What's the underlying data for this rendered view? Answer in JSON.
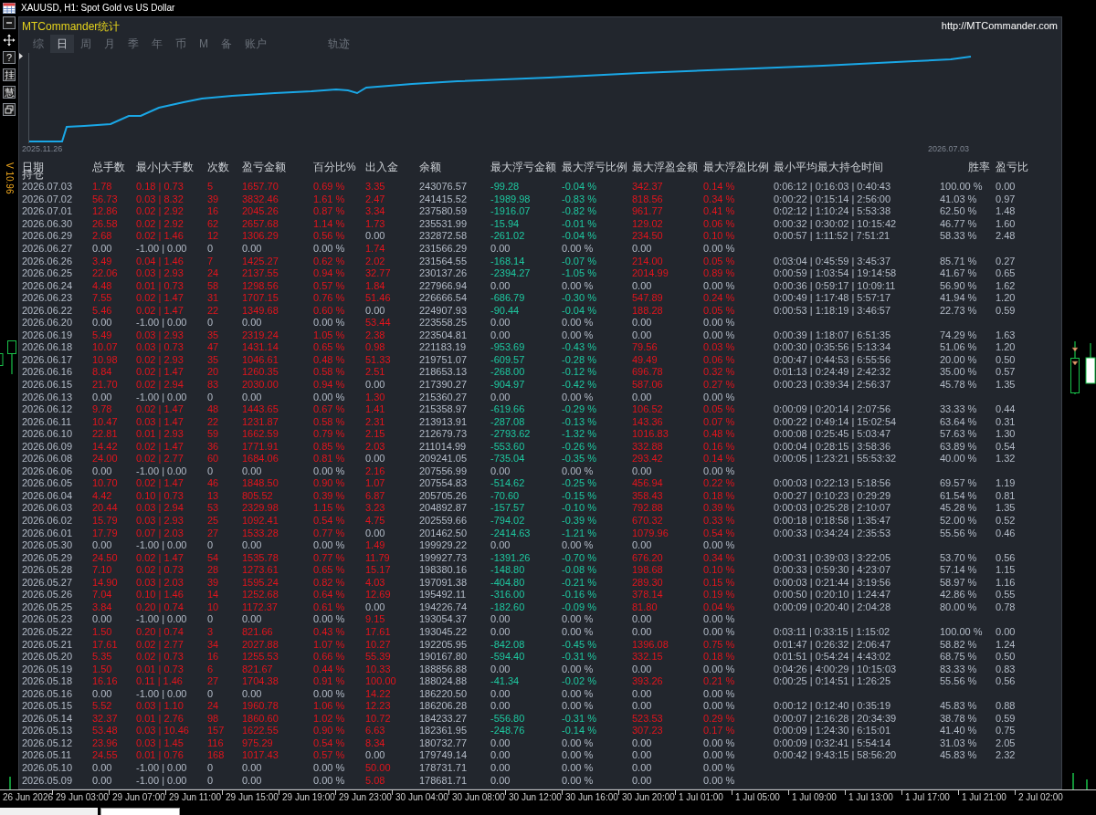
{
  "window": {
    "title": "XAUUSD, H1: Spot Gold vs US Dollar"
  },
  "toolbar_buttons": [
    "?",
    "挂",
    "慧"
  ],
  "version_label": "V 10.96",
  "panel": {
    "title": "MTCommander统计",
    "link": "http://MTCommander.com",
    "tabs": [
      {
        "label": "综",
        "selected": false
      },
      {
        "label": "日",
        "selected": true
      },
      {
        "label": "周",
        "selected": false
      },
      {
        "label": "月",
        "selected": false
      },
      {
        "label": "季",
        "selected": false
      },
      {
        "label": "年",
        "selected": false
      },
      {
        "label": "币",
        "selected": false
      },
      {
        "label": "M",
        "selected": false
      },
      {
        "label": "备",
        "selected": false
      },
      {
        "label": "账户",
        "selected": false
      },
      {
        "label": "轨迹",
        "selected": false
      }
    ],
    "equity_chart": {
      "start_label": "2025.11.26",
      "end_label": "2026.07.03"
    },
    "table": {
      "columns": [
        {
          "label": "日期",
          "kind": "date"
        },
        {
          "label": "总手数",
          "kind": "trade"
        },
        {
          "label": "最小|大手数",
          "kind": "trade"
        },
        {
          "label": "次数",
          "kind": "trade"
        },
        {
          "label": "盈亏金额",
          "kind": "trade"
        },
        {
          "label": "百分比%",
          "kind": "trade"
        },
        {
          "label": "出入金",
          "kind": "cash"
        },
        {
          "label": "余额",
          "kind": "balance"
        },
        {
          "label": "最大浮亏金额",
          "kind": "loss"
        },
        {
          "label": "最大浮亏比例",
          "kind": "loss"
        },
        {
          "label": "最大浮盈金额",
          "kind": "gain"
        },
        {
          "label": "最大浮盈比例",
          "kind": "gain"
        },
        {
          "label": "最小平均最大持仓时间",
          "kind": "plain"
        },
        {
          "label": "胜率",
          "kind": "plain"
        },
        {
          "label": "盈亏比",
          "kind": "plain"
        }
      ],
      "subheader": "持仓",
      "rows": [
        {
          "cells": [
            "2026.07.03",
            "1.78",
            "0.18 | 0.73",
            "5",
            "1657.70",
            "0.69 %",
            "3.35",
            "243076.57",
            "-99.28",
            "-0.04 %",
            "342.37",
            "0.14 %",
            "0:06:12 | 0:16:03 | 0:40:43",
            "100.00 %",
            "0.00"
          ],
          "traded": true,
          "cash_moved": true,
          "floating": true
        },
        {
          "cells": [
            "2026.07.02",
            "56.73",
            "0.03 | 8.32",
            "39",
            "3832.46",
            "1.61 %",
            "2.47",
            "241415.52",
            "-1989.98",
            "-0.83 %",
            "818.56",
            "0.34 %",
            "0:00:22 | 0:15:14 | 2:56:00",
            "41.03 %",
            "0.97"
          ],
          "traded": true,
          "cash_moved": true,
          "floating": true
        },
        {
          "cells": [
            "2026.07.01",
            "12.86",
            "0.02 | 2.92",
            "16",
            "2045.26",
            "0.87 %",
            "3.34",
            "237580.59",
            "-1916.07",
            "-0.82 %",
            "961.77",
            "0.41 %",
            "0:02:12 | 1:10:24 | 5:53:38",
            "62.50 %",
            "1.48"
          ],
          "traded": true,
          "cash_moved": true,
          "floating": true
        },
        {
          "cells": [
            "2026.06.30",
            "26.58",
            "0.02 | 2.92",
            "62",
            "2657.68",
            "1.14 %",
            "1.73",
            "235531.99",
            "-15.94",
            "-0.01 %",
            "129.02",
            "0.06 %",
            "0:00:32 | 0:30:02 | 10:15:42",
            "46.77 %",
            "1.60"
          ],
          "traded": true,
          "cash_moved": true,
          "floating": true
        },
        {
          "cells": [
            "2026.06.29",
            "2.68",
            "0.02 | 1.46",
            "12",
            "1306.29",
            "0.56 %",
            "0.00",
            "232872.58",
            "-261.02",
            "-0.04 %",
            "234.50",
            "0.10 %",
            "0:00:57 | 1:11:52 | 7:51:21",
            "58.33 %",
            "2.48"
          ],
          "traded": true,
          "cash_moved": false,
          "floating": true
        },
        {
          "cells": [
            "2026.06.27",
            "0.00",
            "-1.00 | 0.00",
            "0",
            "0.00",
            "0.00 %",
            "1.74",
            "231566.29",
            "0.00",
            "0.00 %",
            "0.00",
            "0.00 %"
          ],
          "traded": false,
          "cash_moved": true,
          "floating": false
        },
        {
          "cells": [
            "2026.06.26",
            "3.49",
            "0.04 | 1.46",
            "7",
            "1425.27",
            "0.62 %",
            "2.02",
            "231564.55",
            "-168.14",
            "-0.07 %",
            "214.00",
            "0.05 %",
            "0:03:04 | 0:45:59 | 3:45:37",
            "85.71 %",
            "0.27"
          ],
          "traded": true,
          "cash_moved": true,
          "floating": true
        },
        {
          "cells": [
            "2026.06.25",
            "22.06",
            "0.03 | 2.93",
            "24",
            "2137.55",
            "0.94 %",
            "32.77",
            "230137.26",
            "-2394.27",
            "-1.05 %",
            "2014.99",
            "0.89 %",
            "0:00:59 | 1:03:54 | 19:14:58",
            "41.67 %",
            "0.65"
          ],
          "traded": true,
          "cash_moved": true,
          "floating": true
        },
        {
          "cells": [
            "2026.06.24",
            "4.48",
            "0.01 | 0.73",
            "58",
            "1298.56",
            "0.57 %",
            "1.84",
            "227966.94",
            "0.00",
            "0.00 %",
            "0.00",
            "0.00 %",
            "0:00:36 | 0:59:17 | 10:09:11",
            "56.90 %",
            "1.62"
          ],
          "traded": true,
          "cash_moved": true,
          "floating": false
        },
        {
          "cells": [
            "2026.06.23",
            "7.55",
            "0.02 | 1.47",
            "31",
            "1707.15",
            "0.76 %",
            "51.46",
            "226666.54",
            "-686.79",
            "-0.30 %",
            "547.89",
            "0.24 %",
            "0:00:49 | 1:17:48 | 5:57:17",
            "41.94 %",
            "1.20"
          ],
          "traded": true,
          "cash_moved": true,
          "floating": true
        },
        {
          "cells": [
            "2026.06.22",
            "5.46",
            "0.02 | 1.47",
            "22",
            "1349.68",
            "0.60 %",
            "0.00",
            "224907.93",
            "-90.44",
            "-0.04 %",
            "188.28",
            "0.05 %",
            "0:00:53 | 1:18:19 | 3:46:57",
            "22.73 %",
            "0.59"
          ],
          "traded": true,
          "cash_moved": false,
          "floating": true
        },
        {
          "cells": [
            "2026.06.20",
            "0.00",
            "-1.00 | 0.00",
            "0",
            "0.00",
            "0.00 %",
            "53.44",
            "223558.25",
            "0.00",
            "0.00 %",
            "0.00",
            "0.00 %"
          ],
          "traded": false,
          "cash_moved": true,
          "floating": false
        },
        {
          "cells": [
            "2026.06.19",
            "5.49",
            "0.03 | 2.93",
            "35",
            "2319.24",
            "1.05 %",
            "2.38",
            "223504.81",
            "0.00",
            "0.00 %",
            "0.00",
            "0.00 %",
            "0:00:39 | 1:18:07 | 6:51:35",
            "74.29 %",
            "1.63"
          ],
          "traded": true,
          "cash_moved": true,
          "floating": false
        },
        {
          "cells": [
            "2026.06.18",
            "10.07",
            "0.03 | 0.73",
            "47",
            "1431.14",
            "0.65 %",
            "0.98",
            "221183.19",
            "-953.69",
            "-0.43 %",
            "79.56",
            "0.03 %",
            "0:00:30 | 0:35:56 | 5:13:34",
            "51.06 %",
            "1.20"
          ],
          "traded": true,
          "cash_moved": true,
          "floating": true
        },
        {
          "cells": [
            "2026.06.17",
            "10.98",
            "0.02 | 2.93",
            "35",
            "1046.61",
            "0.48 %",
            "51.33",
            "219751.07",
            "-609.57",
            "-0.28 %",
            "49.49",
            "0.06 %",
            "0:00:47 | 0:44:53 | 6:55:56",
            "20.00 %",
            "0.50"
          ],
          "traded": true,
          "cash_moved": true,
          "floating": true
        },
        {
          "cells": [
            "2026.06.16",
            "8.84",
            "0.02 | 1.47",
            "20",
            "1260.35",
            "0.58 %",
            "2.51",
            "218653.13",
            "-268.00",
            "-0.12 %",
            "696.78",
            "0.32 %",
            "0:01:13 | 0:24:49 | 2:42:32",
            "35.00 %",
            "0.57"
          ],
          "traded": true,
          "cash_moved": true,
          "floating": true
        },
        {
          "cells": [
            "2026.06.15",
            "21.70",
            "0.02 | 2.94",
            "83",
            "2030.00",
            "0.94 %",
            "0.00",
            "217390.27",
            "-904.97",
            "-0.42 %",
            "587.06",
            "0.27 %",
            "0:00:23 | 0:39:34 | 2:56:37",
            "45.78 %",
            "1.35"
          ],
          "traded": true,
          "cash_moved": false,
          "floating": true
        },
        {
          "cells": [
            "2026.06.13",
            "0.00",
            "-1.00 | 0.00",
            "0",
            "0.00",
            "0.00 %",
            "1.30",
            "215360.27",
            "0.00",
            "0.00 %",
            "0.00",
            "0.00 %"
          ],
          "traded": false,
          "cash_moved": true,
          "floating": false
        },
        {
          "cells": [
            "2026.06.12",
            "9.78",
            "0.02 | 1.47",
            "48",
            "1443.65",
            "0.67 %",
            "1.41",
            "215358.97",
            "-619.66",
            "-0.29 %",
            "106.52",
            "0.05 %",
            "0:00:09 | 0:20:14 | 2:07:56",
            "33.33 %",
            "0.44"
          ],
          "traded": true,
          "cash_moved": true,
          "floating": true
        },
        {
          "cells": [
            "2026.06.11",
            "10.47",
            "0.03 | 1.47",
            "22",
            "1231.87",
            "0.58 %",
            "2.31",
            "213913.91",
            "-287.08",
            "-0.13 %",
            "143.36",
            "0.07 %",
            "0:00:22 | 0:49:14 | 15:02:54",
            "63.64 %",
            "0.31"
          ],
          "traded": true,
          "cash_moved": true,
          "floating": true
        },
        {
          "cells": [
            "2026.06.10",
            "22.81",
            "0.01 | 2.93",
            "59",
            "1662.59",
            "0.79 %",
            "2.15",
            "212679.73",
            "-2793.62",
            "-1.32 %",
            "1016.83",
            "0.48 %",
            "0:00:08 | 0:25:45 | 5:03:47",
            "57.63 %",
            "1.30"
          ],
          "traded": true,
          "cash_moved": true,
          "floating": true
        },
        {
          "cells": [
            "2026.06.09",
            "14.42",
            "0.02 | 1.47",
            "36",
            "1771.91",
            "0.85 %",
            "2.03",
            "211014.99",
            "-553.60",
            "-0.26 %",
            "332.88",
            "0.16 %",
            "0:00:04 | 0:28:15 | 3:58:36",
            "63.89 %",
            "0.54"
          ],
          "traded": true,
          "cash_moved": true,
          "floating": true
        },
        {
          "cells": [
            "2026.06.08",
            "24.00",
            "0.02 | 2.77",
            "60",
            "1684.06",
            "0.81 %",
            "0.00",
            "209241.05",
            "-735.04",
            "-0.35 %",
            "293.42",
            "0.14 %",
            "0:00:05 | 1:23:21 | 55:53:32",
            "40.00 %",
            "1.32"
          ],
          "traded": true,
          "cash_moved": false,
          "floating": true
        },
        {
          "cells": [
            "2026.06.06",
            "0.00",
            "-1.00 | 0.00",
            "0",
            "0.00",
            "0.00 %",
            "2.16",
            "207556.99",
            "0.00",
            "0.00 %",
            "0.00",
            "0.00 %"
          ],
          "traded": false,
          "cash_moved": true,
          "floating": false
        },
        {
          "cells": [
            "2026.06.05",
            "10.70",
            "0.02 | 1.47",
            "46",
            "1848.50",
            "0.90 %",
            "1.07",
            "207554.83",
            "-514.62",
            "-0.25 %",
            "456.94",
            "0.22 %",
            "0:00:03 | 0:22:13 | 5:18:56",
            "69.57 %",
            "1.19"
          ],
          "traded": true,
          "cash_moved": true,
          "floating": true
        },
        {
          "cells": [
            "2026.06.04",
            "4.42",
            "0.10 | 0.73",
            "13",
            "805.52",
            "0.39 %",
            "6.87",
            "205705.26",
            "-70.60",
            "-0.15 %",
            "358.43",
            "0.18 %",
            "0:00:27 | 0:10:23 | 0:29:29",
            "61.54 %",
            "0.81"
          ],
          "traded": true,
          "cash_moved": true,
          "floating": true
        },
        {
          "cells": [
            "2026.06.03",
            "20.44",
            "0.03 | 2.94",
            "53",
            "2329.98",
            "1.15 %",
            "3.23",
            "204892.87",
            "-157.57",
            "-0.10 %",
            "792.88",
            "0.39 %",
            "0:00:03 | 0:25:28 | 2:10:07",
            "45.28 %",
            "1.35"
          ],
          "traded": true,
          "cash_moved": true,
          "floating": true
        },
        {
          "cells": [
            "2026.06.02",
            "15.79",
            "0.03 | 2.93",
            "25",
            "1092.41",
            "0.54 %",
            "4.75",
            "202559.66",
            "-794.02",
            "-0.39 %",
            "670.32",
            "0.33 %",
            "0:00:18 | 0:18:58 | 1:35:47",
            "52.00 %",
            "0.52"
          ],
          "traded": true,
          "cash_moved": true,
          "floating": true
        },
        {
          "cells": [
            "2026.06.01",
            "17.79",
            "0.07 | 2.03",
            "27",
            "1533.28",
            "0.77 %",
            "0.00",
            "201462.50",
            "-2414.63",
            "-1.21 %",
            "1079.96",
            "0.54 %",
            "0:00:33 | 0:34:24 | 2:35:53",
            "55.56 %",
            "0.46"
          ],
          "traded": true,
          "cash_moved": false,
          "floating": true
        },
        {
          "cells": [
            "2026.05.30",
            "0.00",
            "-1.00 | 0.00",
            "0",
            "0.00",
            "0.00 %",
            "1.49",
            "199929.22",
            "0.00",
            "0.00 %",
            "0.00",
            "0.00 %"
          ],
          "traded": false,
          "cash_moved": true,
          "floating": false
        },
        {
          "cells": [
            "2026.05.29",
            "24.50",
            "0.02 | 1.47",
            "54",
            "1535.78",
            "0.77 %",
            "11.79",
            "199927.73",
            "-1391.26",
            "-0.70 %",
            "676.20",
            "0.34 %",
            "0:00:31 | 0:39:03 | 3:22:05",
            "53.70 %",
            "0.56"
          ],
          "traded": true,
          "cash_moved": true,
          "floating": true
        },
        {
          "cells": [
            "2026.05.28",
            "7.10",
            "0.02 | 0.73",
            "28",
            "1273.61",
            "0.65 %",
            "15.17",
            "198380.16",
            "-148.80",
            "-0.08 %",
            "198.68",
            "0.10 %",
            "0:00:33 | 0:59:30 | 4:23:07",
            "57.14 %",
            "1.15"
          ],
          "traded": true,
          "cash_moved": true,
          "floating": true
        },
        {
          "cells": [
            "2026.05.27",
            "14.90",
            "0.03 | 2.03",
            "39",
            "1595.24",
            "0.82 %",
            "4.03",
            "197091.38",
            "-404.80",
            "-0.21 %",
            "289.30",
            "0.15 %",
            "0:00:03 | 0:21:44 | 3:19:56",
            "58.97 %",
            "1.16"
          ],
          "traded": true,
          "cash_moved": true,
          "floating": true
        },
        {
          "cells": [
            "2026.05.26",
            "7.04",
            "0.10 | 1.46",
            "14",
            "1252.68",
            "0.64 %",
            "12.69",
            "195492.11",
            "-316.00",
            "-0.16 %",
            "378.14",
            "0.19 %",
            "0:00:50 | 0:20:10 | 1:24:47",
            "42.86 %",
            "0.55"
          ],
          "traded": true,
          "cash_moved": true,
          "floating": true
        },
        {
          "cells": [
            "2026.05.25",
            "3.84",
            "0.20 | 0.74",
            "10",
            "1172.37",
            "0.61 %",
            "0.00",
            "194226.74",
            "-182.60",
            "-0.09 %",
            "81.80",
            "0.04 %",
            "0:00:09 | 0:20:40 | 2:04:28",
            "80.00 %",
            "0.78"
          ],
          "traded": true,
          "cash_moved": false,
          "floating": true
        },
        {
          "cells": [
            "2026.05.23",
            "0.00",
            "-1.00 | 0.00",
            "0",
            "0.00",
            "0.00 %",
            "9.15",
            "193054.37",
            "0.00",
            "0.00 %",
            "0.00",
            "0.00 %"
          ],
          "traded": false,
          "cash_moved": true,
          "floating": false
        },
        {
          "cells": [
            "2026.05.22",
            "1.50",
            "0.20 | 0.74",
            "3",
            "821.66",
            "0.43 %",
            "17.61",
            "193045.22",
            "0.00",
            "0.00 %",
            "0.00",
            "0.00 %",
            "0:03:11 | 0:33:15 | 1:15:02",
            "100.00 %",
            "0.00"
          ],
          "traded": true,
          "cash_moved": true,
          "floating": false
        },
        {
          "cells": [
            "2026.05.21",
            "17.61",
            "0.02 | 2.77",
            "34",
            "2027.88",
            "1.07 %",
            "10.27",
            "192205.95",
            "-842.08",
            "-0.45 %",
            "1396.08",
            "0.75 %",
            "0:01:47 | 0:26:32 | 2:06:47",
            "58.82 %",
            "1.24"
          ],
          "traded": true,
          "cash_moved": true,
          "floating": true
        },
        {
          "cells": [
            "2026.05.20",
            "5.35",
            "0.02 | 0.73",
            "16",
            "1255.53",
            "0.66 %",
            "55.39",
            "190167.80",
            "-594.40",
            "-0.31 %",
            "332.15",
            "0.18 %",
            "0:01:51 | 0:54:24 | 4:43:02",
            "68.75 %",
            "0.50"
          ],
          "traded": true,
          "cash_moved": true,
          "floating": true
        },
        {
          "cells": [
            "2026.05.19",
            "1.50",
            "0.01 | 0.73",
            "6",
            "821.67",
            "0.44 %",
            "10.33",
            "188856.88",
            "0.00",
            "0.00 %",
            "0.00",
            "0.00 %",
            "0:04:26 | 4:00:29 | 10:15:03",
            "83.33 %",
            "0.83"
          ],
          "traded": true,
          "cash_moved": true,
          "floating": false
        },
        {
          "cells": [
            "2026.05.18",
            "16.16",
            "0.11 | 1.46",
            "27",
            "1704.38",
            "0.91 %",
            "100.00",
            "188024.88",
            "-41.34",
            "-0.02 %",
            "393.26",
            "0.21 %",
            "0:00:25 | 0:14:51 | 1:26:25",
            "55.56 %",
            "0.56"
          ],
          "traded": true,
          "cash_moved": true,
          "floating": true
        },
        {
          "cells": [
            "2026.05.16",
            "0.00",
            "-1.00 | 0.00",
            "0",
            "0.00",
            "0.00 %",
            "14.22",
            "186220.50",
            "0.00",
            "0.00 %",
            "0.00",
            "0.00 %"
          ],
          "traded": false,
          "cash_moved": true,
          "floating": false
        },
        {
          "cells": [
            "2026.05.15",
            "5.52",
            "0.03 | 1.10",
            "24",
            "1960.78",
            "1.06 %",
            "12.23",
            "186206.28",
            "0.00",
            "0.00 %",
            "0.00",
            "0.00 %",
            "0:00:12 | 0:12:40 | 0:35:19",
            "45.83 %",
            "0.88"
          ],
          "traded": true,
          "cash_moved": true,
          "floating": false
        },
        {
          "cells": [
            "2026.05.14",
            "32.37",
            "0.01 | 2.76",
            "98",
            "1860.60",
            "1.02 %",
            "10.72",
            "184233.27",
            "-556.80",
            "-0.31 %",
            "523.53",
            "0.29 %",
            "0:00:07 | 2:16:28 | 20:34:39",
            "38.78 %",
            "0.59"
          ],
          "traded": true,
          "cash_moved": true,
          "floating": true
        },
        {
          "cells": [
            "2026.05.13",
            "53.48",
            "0.03 | 10.46",
            "157",
            "1622.55",
            "0.90 %",
            "6.63",
            "182361.95",
            "-248.76",
            "-0.14 %",
            "307.23",
            "0.17 %",
            "0:00:09 | 1:24:30 | 6:15:01",
            "41.40 %",
            "0.75"
          ],
          "traded": true,
          "cash_moved": true,
          "floating": true
        },
        {
          "cells": [
            "2026.05.12",
            "23.96",
            "0.03 | 1.45",
            "116",
            "975.29",
            "0.54 %",
            "8.34",
            "180732.77",
            "0.00",
            "0.00 %",
            "0.00",
            "0.00 %",
            "0:00:09 | 0:32:41 | 5:54:14",
            "31.03 %",
            "2.05"
          ],
          "traded": true,
          "cash_moved": true,
          "floating": false
        },
        {
          "cells": [
            "2026.05.11",
            "24.55",
            "0.01 | 0.76",
            "168",
            "1017.43",
            "0.57 %",
            "0.00",
            "179749.14",
            "0.00",
            "0.00 %",
            "0.00",
            "0.00 %",
            "0:00:42 | 9:43:15 | 58:56:20",
            "45.83 %",
            "2.32"
          ],
          "traded": true,
          "cash_moved": false,
          "floating": false
        },
        {
          "cells": [
            "2026.05.10",
            "0.00",
            "-1.00 | 0.00",
            "0",
            "0.00",
            "0.00 %",
            "50.00",
            "178731.71",
            "0.00",
            "0.00 %",
            "0.00",
            "0.00 %"
          ],
          "traded": false,
          "cash_moved": true,
          "floating": false
        },
        {
          "cells": [
            "2026.05.09",
            "0.00",
            "-1.00 | 0.00",
            "0",
            "0.00",
            "0.00 %",
            "5.08",
            "178681.71",
            "0.00",
            "0.00 %",
            "0.00",
            "0.00 %"
          ],
          "traded": false,
          "cash_moved": true,
          "floating": false
        }
      ]
    }
  },
  "time_axis": {
    "labels": [
      "26 Jun 2026",
      "29 Jun 03:00",
      "29 Jun 07:00",
      "29 Jun 11:00",
      "29 Jun 15:00",
      "29 Jun 19:00",
      "29 Jun 23:00",
      "30 Jun 04:00",
      "30 Jun 08:00",
      "30 Jun 12:00",
      "30 Jun 16:00",
      "30 Jun 20:00",
      "1 Jul 01:00",
      "1 Jul 05:00",
      "1 Jul 09:00",
      "1 Jul 13:00",
      "1 Jul 17:00",
      "1 Jul 21:00",
      "2 Jul 02:00"
    ]
  }
}
